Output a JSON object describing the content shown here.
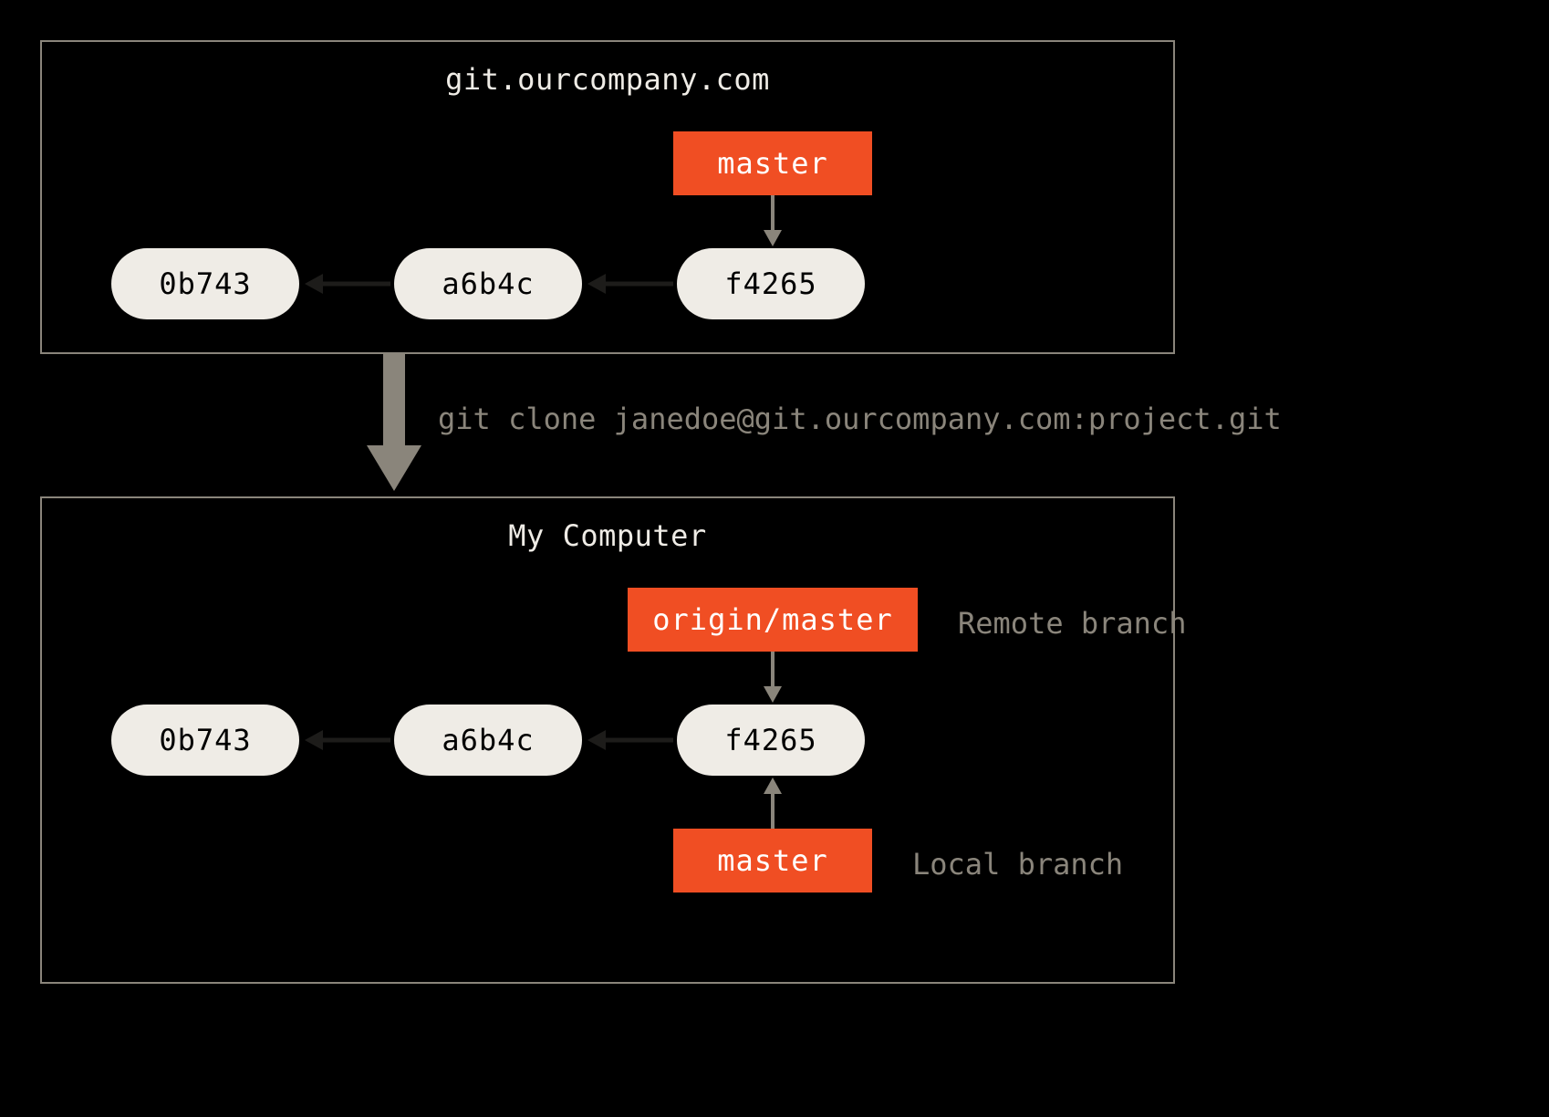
{
  "colors": {
    "bg": "#000000",
    "panel_border": "#8a857b",
    "commit_fill": "#efece6",
    "branch_fill": "#f04e23",
    "muted_text": "#8a857b",
    "arrow_muted": "#8a857b",
    "arrow_dark": "#1d1c1a"
  },
  "remote": {
    "title": "git.ourcompany.com",
    "branch_master": "master",
    "commits": [
      "0b743",
      "a6b4c",
      "f4265"
    ]
  },
  "clone": {
    "command": "git clone janedoe@git.ourcompany.com:project.git"
  },
  "local": {
    "title": "My Computer",
    "branch_origin_master": "origin/master",
    "branch_master": "master",
    "commits": [
      "0b743",
      "a6b4c",
      "f4265"
    ],
    "remote_branch_label": "Remote branch",
    "local_branch_label": "Local branch"
  }
}
